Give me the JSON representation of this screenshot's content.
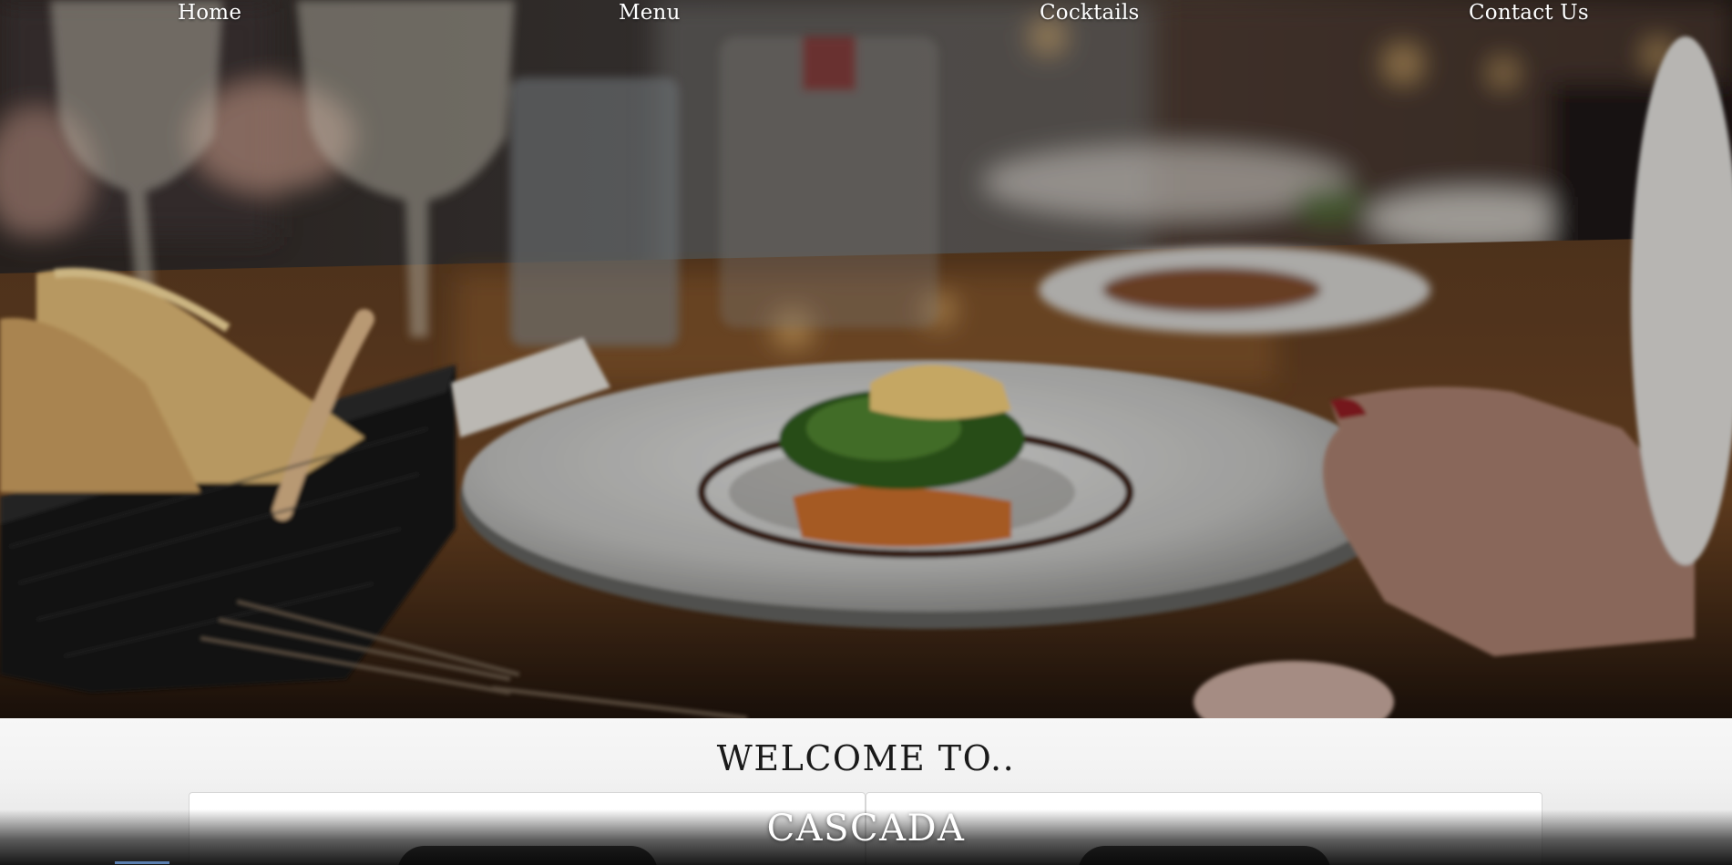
{
  "nav": {
    "items": [
      {
        "label": "Home"
      },
      {
        "label": "Menu"
      },
      {
        "label": "Cocktails"
      },
      {
        "label": "Contact Us"
      }
    ]
  },
  "hero": {
    "image": "restaurant-dinner-table-photo"
  },
  "welcome": {
    "heading": "WELCOME TO..",
    "brand": "CASCADA"
  }
}
